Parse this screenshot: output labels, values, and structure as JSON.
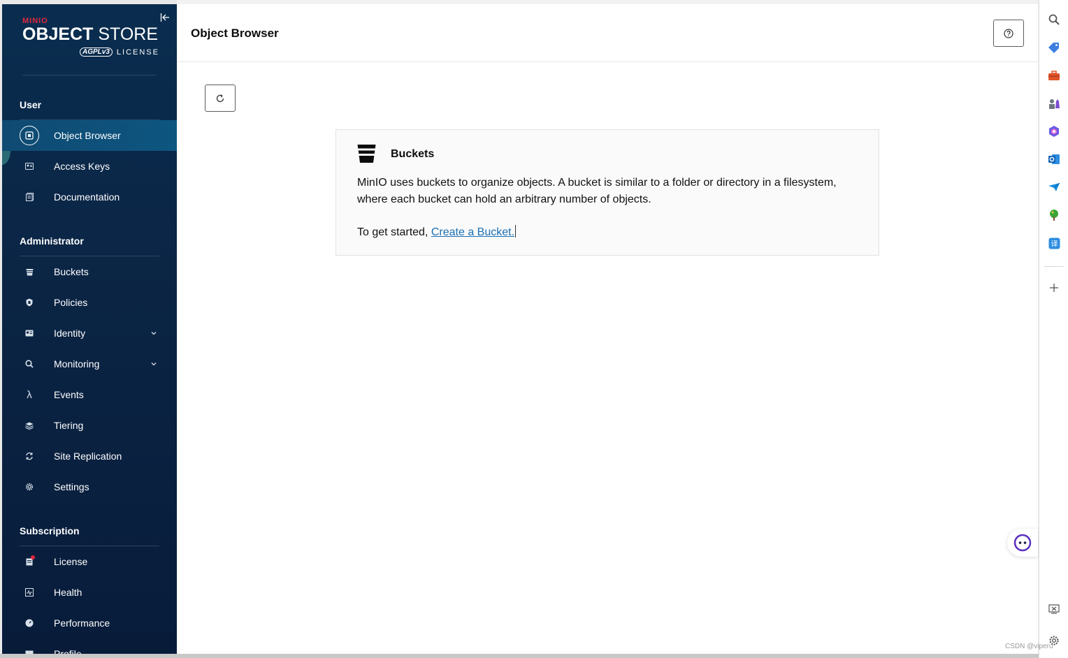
{
  "brand": {
    "minio": "MINIO",
    "title_bold": "OBJECT",
    "title_light": " STORE",
    "agpl": "AGPLv3",
    "license": "LICENSE"
  },
  "sidebar": {
    "sections": {
      "user": "User",
      "administrator": "Administrator",
      "subscription": "Subscription"
    },
    "user_items": [
      {
        "label": "Object Browser",
        "icon": "object-browser-icon"
      },
      {
        "label": "Access Keys",
        "icon": "access-keys-icon"
      },
      {
        "label": "Documentation",
        "icon": "documentation-icon"
      }
    ],
    "admin_items": [
      {
        "label": "Buckets",
        "icon": "bucket-icon"
      },
      {
        "label": "Policies",
        "icon": "shield-icon"
      },
      {
        "label": "Identity",
        "icon": "identity-icon"
      },
      {
        "label": "Monitoring",
        "icon": "monitoring-icon"
      },
      {
        "label": "Events",
        "icon": "lambda-icon"
      },
      {
        "label": "Tiering",
        "icon": "layers-icon"
      },
      {
        "label": "Site Replication",
        "icon": "replication-icon"
      },
      {
        "label": "Settings",
        "icon": "gear-icon"
      }
    ],
    "subscription_items": [
      {
        "label": "License",
        "icon": "license-icon"
      },
      {
        "label": "Health",
        "icon": "health-icon"
      },
      {
        "label": "Performance",
        "icon": "performance-icon"
      },
      {
        "label": "Profile",
        "icon": "profile-icon"
      }
    ]
  },
  "header": {
    "title": "Object Browser"
  },
  "card": {
    "title": "Buckets",
    "description": "MinIO uses buckets to organize objects. A bucket is similar to a folder or directory in a filesystem, where each bucket can hold an arbitrary number of objects.",
    "start_prefix": "To get started, ",
    "start_link": "Create a Bucket."
  },
  "watermark": "CSDN @viperu",
  "colors": {
    "sidebar_bg": "#0b2545",
    "active_bg": "#0d5680",
    "link": "#1a6fb4",
    "accent_red": "#e3283e"
  }
}
